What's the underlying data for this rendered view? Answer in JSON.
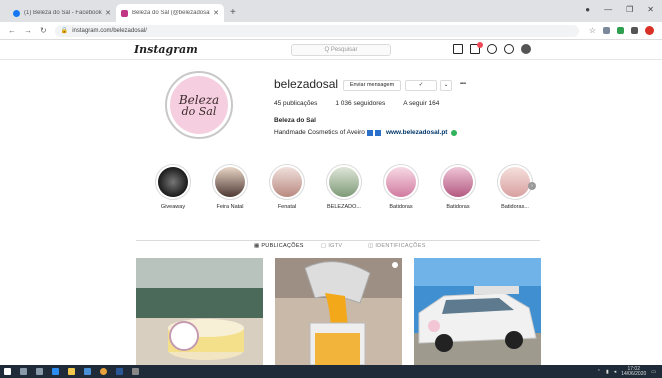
{
  "browser": {
    "tabs": [
      {
        "title": "(1) Beleza do Sal - Facebook",
        "favicon_color": "#1877f2",
        "active": false
      },
      {
        "title": "Beleza do Sal (@belezadosal) • Instagram",
        "favicon_color": "#c13584",
        "active": true
      }
    ],
    "new_tab": "+",
    "url": "instagram.com/belezadosal/",
    "window_controls": [
      "—",
      "❐",
      "✕"
    ]
  },
  "instagram": {
    "logo": "Instagram",
    "search_placeholder": "Q Pesquisar"
  },
  "profile": {
    "username": "belezadosal",
    "message_button": "Enviar mensagem",
    "follow_button": "✓",
    "more": "•••",
    "posts": "45 publicações",
    "followers": "1 036 seguidores",
    "following": "A seguir 164",
    "full_name": "Beleza do Sal",
    "bio": "Handmade Cosmetics of Aveiro",
    "website": "www.belezadosal.pt",
    "avatar_line1": "Beleza",
    "avatar_line2": "do Sal"
  },
  "highlights": [
    {
      "label": "Giveaway",
      "color": "#2b2b2b"
    },
    {
      "label": "Feira Natal",
      "color": "#6b4f4f"
    },
    {
      "label": "Fenatal",
      "color": "#c9a8a0"
    },
    {
      "label": "BELEZADO...",
      "color": "#8fa58a"
    },
    {
      "label": "Batidoras",
      "color": "#d88aa8"
    },
    {
      "label": "Batidoras",
      "color": "#c56c92"
    },
    {
      "label": "Batidoras...",
      "color": "#e8b5b5"
    }
  ],
  "profile_tabs": [
    "PUBLICAÇÕES",
    "IGTV",
    "IDENTIFICAÇÕES"
  ],
  "taskbar": {
    "time": "17:02",
    "date": "14/06/2020"
  }
}
